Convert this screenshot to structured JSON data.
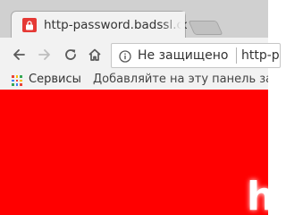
{
  "browser": {
    "tab": {
      "title": "http-password.badssl.com",
      "favicon": "lock-icon",
      "favicon_color": "#e53935"
    },
    "new_tab": "new-tab-icon",
    "toolbar": {
      "back": "back-arrow-icon",
      "forward": "forward-arrow-icon",
      "reload": "reload-icon",
      "home": "home-icon"
    },
    "omnibox": {
      "security_icon": "info-icon",
      "security_label": "Не защищено",
      "url": "http-password.badssl.com"
    },
    "bookmarks_bar": {
      "apps_icon": "apps-grid-icon",
      "apps_label": "Сервисы",
      "hint": "Добавляйте на эту панель закладки"
    }
  },
  "page": {
    "background": "#ff0000",
    "heading_fragment": "h"
  }
}
